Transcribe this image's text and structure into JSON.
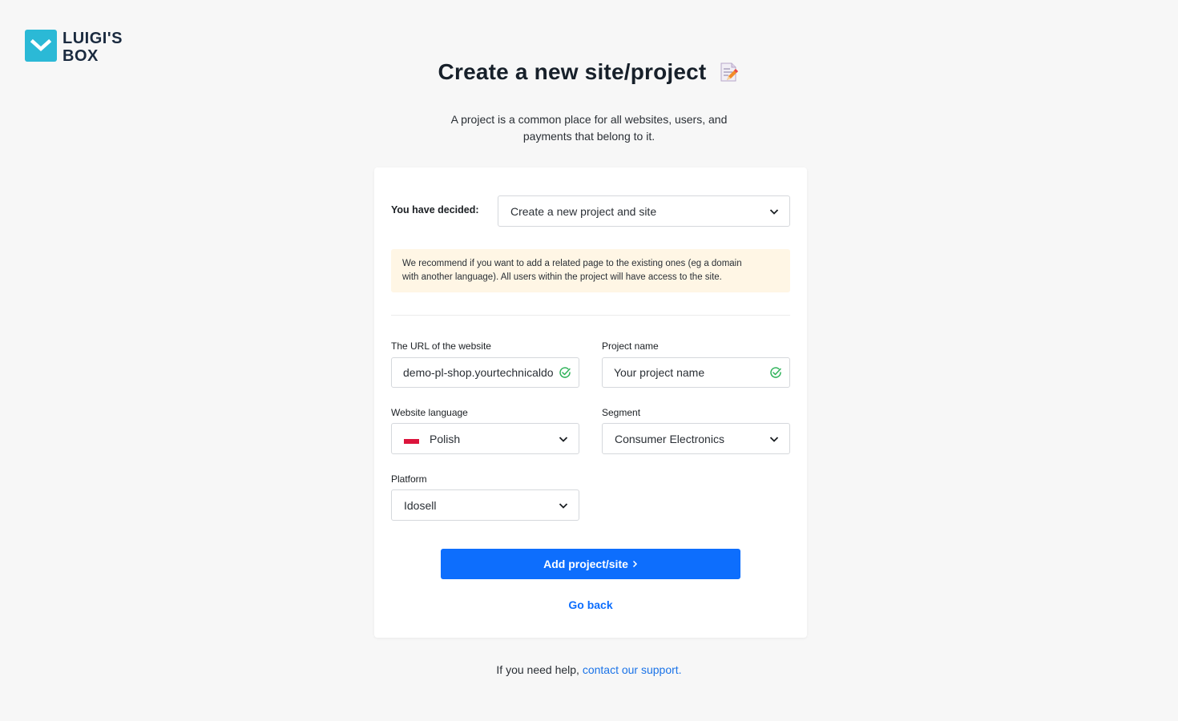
{
  "brand": {
    "line1": "LUIGI'S",
    "line2": "BOX",
    "accent": "#2bb9d6"
  },
  "page": {
    "title": "Create a new site/project",
    "title_icon": "memo-pencil-icon",
    "subtitle_line1": "A project is a common place for all websites, users, and",
    "subtitle_line2": "payments that belong to it."
  },
  "form": {
    "decided_label": "You have decided:",
    "decided_value": "Create a new project and site",
    "notice_line1": "We recommend if you want to add a related page to the existing ones (eg a domain",
    "notice_line2": "with another language). All users within the project will have access to the site.",
    "url_label": "The URL of the website",
    "url_value": "demo-pl-shop.yourtechnicaldomain.com",
    "project_label": "Project name",
    "project_value": "Your project name",
    "language_label": "Website language",
    "language_value": "Polish",
    "segment_label": "Segment",
    "segment_value": "Consumer Electronics",
    "platform_label": "Platform",
    "platform_value": "Idosell",
    "submit_label": "Add project/site",
    "back_label": "Go back"
  },
  "footer": {
    "help_text": "If you need help, ",
    "support_link": "contact our support."
  },
  "colors": {
    "primary": "#0d6efd",
    "success": "#2fb35a",
    "notice_bg": "#fff6e5"
  }
}
